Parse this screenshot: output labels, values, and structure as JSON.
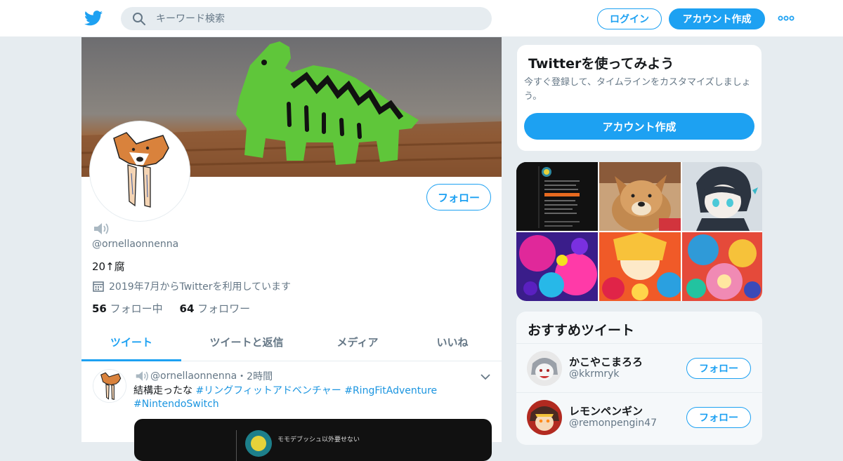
{
  "search": {
    "placeholder": "キーワード検索"
  },
  "header": {
    "login_label": "ログイン",
    "signup_label": "アカウント作成"
  },
  "profile": {
    "follow_label": "フォロー",
    "handle": "@ornellaonnenna",
    "bio": "20↑腐",
    "joined": "2019年7月からTwitterを利用しています",
    "following_count": "56",
    "following_label": "フォロー中",
    "followers_count": "64",
    "followers_label": "フォロワー"
  },
  "tabs": [
    {
      "label": "ツイート"
    },
    {
      "label": "ツイートと返信"
    },
    {
      "label": "メディア"
    },
    {
      "label": "いいね"
    }
  ],
  "tweet": {
    "handle": "@ornellaonnenna",
    "time": "・2時間",
    "text": "結構走ったな ",
    "tag1": "#リングフィットアドベンチャー",
    "tag2": "#RingFitAdventure",
    "tag3": "#NintendoSwitch",
    "media_caption": "モモデブッシュ以外要せない"
  },
  "signup_card": {
    "title": "Twitterを使ってみよう",
    "text": "今すぐ登録して、タイムラインをカスタマイズしましょう。",
    "button": "アカウント作成"
  },
  "recommend": {
    "title": "おすすめツイート",
    "items": [
      {
        "name": "かこやこまろろ",
        "handle": "@kkrmryk",
        "button": "フォロー"
      },
      {
        "name": "レモンペンギン",
        "handle": "@remonpengin47",
        "button": "フォロー"
      }
    ]
  },
  "colors": {
    "accent": "#1da1f2",
    "bg": "#e6ecf0",
    "muted": "#657786"
  },
  "icons": [
    "twitter-bird-icon",
    "search-icon",
    "more-dots-icon",
    "speaker-icon",
    "calendar-icon",
    "chevron-down-icon"
  ]
}
